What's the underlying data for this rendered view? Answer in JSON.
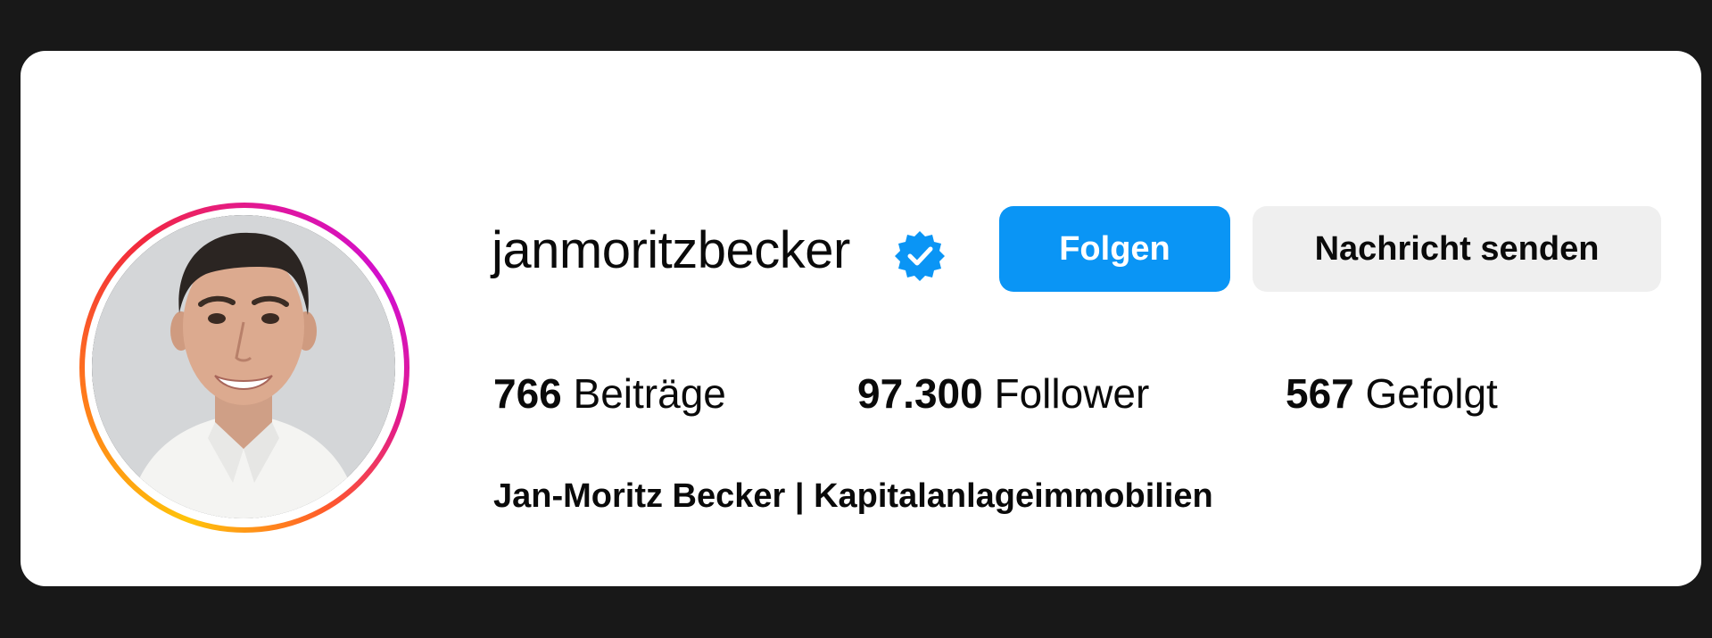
{
  "profile": {
    "username": "janmoritzbecker",
    "verified_icon": "verified-badge-icon",
    "display_name": "Jan-Moritz Becker | Kapitalanlageimmobilien",
    "avatar_icon": "profile-photo"
  },
  "actions": {
    "follow_label": "Folgen",
    "message_label": "Nachricht senden"
  },
  "stats": {
    "posts": {
      "count": "766",
      "label": "Beiträge"
    },
    "followers": {
      "count": "97.300",
      "label": "Follower"
    },
    "following": {
      "count": "567",
      "label": "Gefolgt"
    }
  },
  "colors": {
    "follow_button": "#0a95f5",
    "message_button": "#efefef",
    "verified_badge": "#0a95f5",
    "story_ring_start": "#ffc40a",
    "story_ring_end": "#d10fcf"
  }
}
